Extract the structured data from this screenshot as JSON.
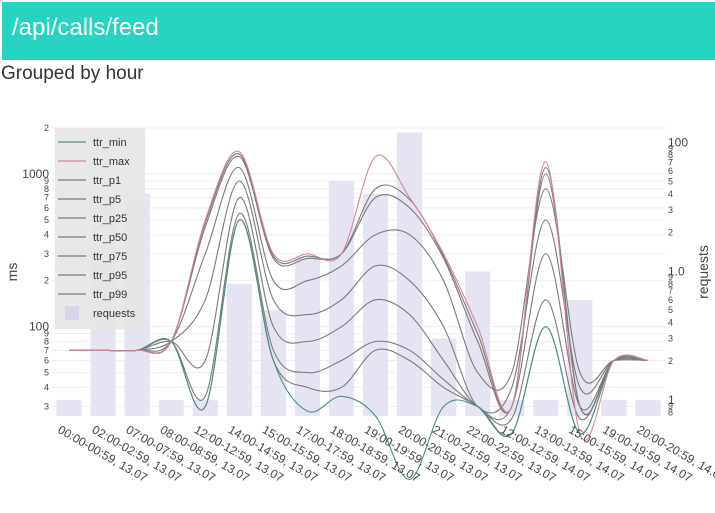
{
  "header": {
    "title": "/api/calls/feed"
  },
  "subtitle": "Grouped by hour",
  "colors": {
    "header_bg": "#26d4c1",
    "ttr_min": "#4a8f88",
    "ttr_max": "#d8869a",
    "percentiles": "#7a7a7a",
    "requests": "#e6e4f2",
    "legend_bg": "#e6e6e6"
  },
  "chart_data": {
    "type": "bar+line",
    "categories": [
      "00:00-00:59, 13.07",
      "02:00-02:59, 13.07",
      "07:00-07:59, 13.07",
      "08:00-08:59, 13.07",
      "12:00-12:59, 13.07",
      "14:00-14:59, 13.07",
      "15:00-15:59, 13.07",
      "17:00-17:59, 13.07",
      "18:00-18:59, 13.07",
      "19:00-19:59, 13.07",
      "20:00-20:59, 13.07",
      "21:00-21:59, 13.07",
      "22:00-22:59, 13.07",
      "12:00-12:59, 14.07",
      "13:00-13:59, 14.07",
      "15:00-15:59, 14.07",
      "19:00-19:59, 14.07",
      "20:00-20:59, 14.07"
    ],
    "left_axis": {
      "label": "ms",
      "scale": "log",
      "range": [
        250,
        2100
      ],
      "tick_values": [
        300,
        400,
        500,
        600,
        700,
        800,
        900,
        1000,
        2000
      ],
      "tick_labels": [
        "3",
        "4",
        "5",
        "6",
        "7",
        "8",
        "9",
        "1000",
        "2"
      ],
      "extra_tick_values": [
        100,
        200
      ],
      "extra_tick_labels": [
        "100",
        "2"
      ]
    },
    "right_axis": {
      "label": "requests",
      "scale": "log",
      "range": [
        0.8,
        1.25
      ],
      "tick_values": [
        0.8,
        0.9,
        1.0,
        0.8,
        0.9,
        1.0
      ],
      "tick_labels": [
        "8",
        "9",
        "1",
        "8",
        "9",
        "1"
      ]
    },
    "left_ticks": [
      {
        "label": "2",
        "v": 2000
      },
      {
        "label": "1000",
        "v": 1000
      },
      {
        "label": "9",
        "v": 900
      },
      {
        "label": "8",
        "v": 800
      },
      {
        "label": "7",
        "v": 700
      },
      {
        "label": "6",
        "v": 600
      },
      {
        "label": "5",
        "v": 500
      },
      {
        "label": "4",
        "v": 400
      },
      {
        "label": "3",
        "v": 300
      },
      {
        "label": "2",
        "v": 200
      },
      {
        "label": "100",
        "v": 100
      },
      {
        "label": "9",
        "v": 90
      },
      {
        "label": "8",
        "v": 80
      },
      {
        "label": "7",
        "v": 70
      },
      {
        "label": "6",
        "v": 60
      },
      {
        "label": "5",
        "v": 50
      },
      {
        "label": "4",
        "v": 40
      },
      {
        "label": "3",
        "v": 30
      }
    ],
    "right_ticks": [
      {
        "label": "100",
        "v": 100
      },
      {
        "label": "9",
        "v": 90
      },
      {
        "label": "8",
        "v": 80
      },
      {
        "label": "7",
        "v": 70
      },
      {
        "label": "6",
        "v": 60
      },
      {
        "label": "5",
        "v": 50
      },
      {
        "label": "4",
        "v": 40
      },
      {
        "label": "3",
        "v": 30
      },
      {
        "label": "2",
        "v": 20
      },
      {
        "label": "10",
        "v": 10
      },
      {
        "label": "9",
        "v": 9
      },
      {
        "label": "8",
        "v": 8
      },
      {
        "label": "7",
        "v": 7
      },
      {
        "label": "6",
        "v": 6
      },
      {
        "label": "5",
        "v": 5
      },
      {
        "label": "4",
        "v": 4
      },
      {
        "label": "3",
        "v": 3
      },
      {
        "label": "2",
        "v": 2
      },
      {
        "label": "1",
        "v": 1
      },
      {
        "label": "9",
        "v": 0.9
      },
      {
        "label": "8",
        "v": 0.8
      }
    ],
    "left_range": [
      26,
      2000
    ],
    "right_range": [
      0.75,
      130
    ],
    "requests": [
      1,
      40,
      40,
      1,
      1,
      8,
      5,
      13,
      50,
      40,
      120,
      3,
      10,
      1,
      1,
      6,
      1,
      1
    ],
    "series": [
      {
        "name": "ttr_min",
        "values": [
          70,
          70,
          70,
          80,
          30,
          500,
          60,
          28,
          35,
          26,
          10,
          30,
          30,
          20,
          100,
          20,
          60,
          60
        ]
      },
      {
        "name": "ttr_max",
        "values": [
          70,
          70,
          70,
          80,
          500,
          1400,
          300,
          300,
          300,
          1300,
          700,
          300,
          100,
          30,
          1200,
          20,
          60,
          60
        ]
      },
      {
        "name": "ttr_p1",
        "values": [
          70,
          70,
          70,
          80,
          30,
          500,
          60,
          40,
          40,
          70,
          60,
          40,
          30,
          20,
          100,
          20,
          60,
          60
        ]
      },
      {
        "name": "ttr_p5",
        "values": [
          70,
          70,
          70,
          80,
          35,
          550,
          70,
          50,
          60,
          80,
          70,
          45,
          30,
          25,
          150,
          25,
          60,
          60
        ]
      },
      {
        "name": "ttr_p25",
        "values": [
          70,
          70,
          70,
          80,
          60,
          700,
          100,
          80,
          100,
          150,
          120,
          60,
          30,
          30,
          300,
          30,
          60,
          60
        ]
      },
      {
        "name": "ttr_p50",
        "values": [
          70,
          70,
          70,
          80,
          150,
          900,
          150,
          120,
          150,
          250,
          200,
          100,
          30,
          40,
          500,
          40,
          60,
          60
        ]
      },
      {
        "name": "ttr_p75",
        "values": [
          70,
          70,
          70,
          80,
          300,
          1100,
          200,
          200,
          250,
          400,
          400,
          200,
          50,
          50,
          800,
          50,
          60,
          60
        ]
      },
      {
        "name": "ttr_p95",
        "values": [
          70,
          70,
          70,
          80,
          450,
          1300,
          280,
          280,
          300,
          700,
          600,
          280,
          80,
          30,
          1000,
          30,
          60,
          60
        ]
      },
      {
        "name": "ttr_p99",
        "values": [
          70,
          70,
          70,
          80,
          480,
          1350,
          290,
          290,
          300,
          800,
          680,
          290,
          90,
          30,
          1100,
          30,
          60,
          60
        ]
      }
    ],
    "legend": [
      "ttr_min",
      "ttr_max",
      "ttr_p1",
      "ttr_p5",
      "ttr_p25",
      "ttr_p50",
      "ttr_p75",
      "ttr_p95",
      "ttr_p99",
      "requests"
    ],
    "legend_position": "top-left",
    "ylabel_left": "ms",
    "ylabel_right": "requests",
    "grid": true
  }
}
